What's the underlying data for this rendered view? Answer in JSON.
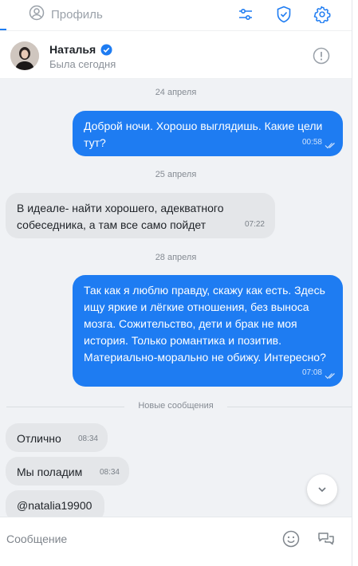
{
  "topbar": {
    "profile_label": "Профиль"
  },
  "header": {
    "name": "Наталья",
    "status": "Была сегодня"
  },
  "messages": [
    {
      "date": "24 апреля"
    },
    {
      "text": "Доброй ночи. Хорошо выглядишь. Какие цели тут?",
      "time": "00:58",
      "direction": "out"
    },
    {
      "date": "25 апреля"
    },
    {
      "text": "В идеале- найти хорошего, адекватного собеседника, а там все само пойдет",
      "time": "07:22",
      "direction": "in"
    },
    {
      "date": "28 апреля"
    },
    {
      "text": "Так как я люблю правду, скажу как есть. Здесь ищу яркие и лёгкие отношения, без выноса мозга. Сожительство, дети и брак не моя история. Только романтика и позитив. Материально-морально не обижу. Интересно?",
      "time": "07:08",
      "direction": "out"
    },
    {
      "divider": "Новые сообщения"
    },
    {
      "text": "Отлично",
      "time": "08:34",
      "direction": "in"
    },
    {
      "text": "Мы поладим",
      "time": "08:34",
      "direction": "in"
    },
    {
      "text": "@natalia19900",
      "direction": "in"
    }
  ],
  "composer": {
    "placeholder": "Сообщение"
  },
  "colors": {
    "accent": "#1e7cf2",
    "incoming_bubble": "#e4e6e9",
    "chat_background": "#f0f2f5"
  },
  "icons": [
    "user-circle-icon",
    "sliders-icon",
    "shield-check-icon",
    "gear-icon",
    "verified-badge-icon",
    "info-icon",
    "double-check-icon",
    "chevron-down-icon",
    "emoji-icon",
    "chat-bubbles-icon"
  ]
}
